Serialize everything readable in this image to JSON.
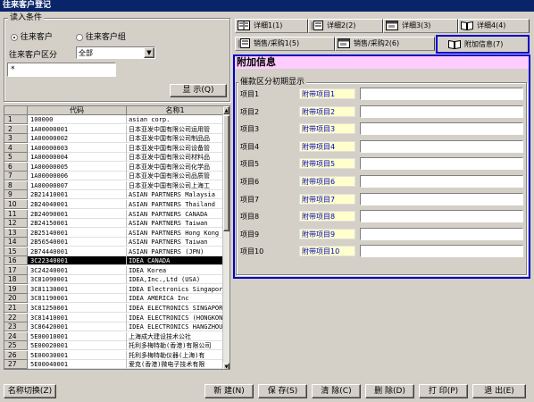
{
  "window": {
    "title": "往来客户登记"
  },
  "filter": {
    "group_label": "读入条件",
    "radio_customer": "往来客户",
    "radio_group": "往来客户组",
    "type_label": "往来客户区分",
    "type_value": "全部",
    "search_value": "*",
    "show_button": "显 示(Q)"
  },
  "grid": {
    "col_code": "代码",
    "col_name": "名称1",
    "rows": [
      {
        "n": "1",
        "code": "100000",
        "name": "asian corp."
      },
      {
        "n": "2",
        "code": "1A00000001",
        "name": "日本亚发中国有限公司运用管"
      },
      {
        "n": "3",
        "code": "1A00000002",
        "name": "日本亚发中国有限公司制品品"
      },
      {
        "n": "4",
        "code": "1A00000003",
        "name": "日本亚发中国有限公司设备管"
      },
      {
        "n": "5",
        "code": "1A00000004",
        "name": "日本亚发中国有限公司材料品"
      },
      {
        "n": "6",
        "code": "1A00000005",
        "name": "日本亚发中国有限公司化学品"
      },
      {
        "n": "7",
        "code": "1A00000006",
        "name": "日本亚发中国有限公司品质管"
      },
      {
        "n": "8",
        "code": "1A00000007",
        "name": "日本亚发中国有限公司上海工"
      },
      {
        "n": "9",
        "code": "2B21410001",
        "name": "ASIAN PARTNERS Malaysia"
      },
      {
        "n": "10",
        "code": "2B24040001",
        "name": "ASIAN PARTNERS Thailand"
      },
      {
        "n": "11",
        "code": "2B24090001",
        "name": "ASIAN PARTNERS CANADA"
      },
      {
        "n": "12",
        "code": "2B24150001",
        "name": "ASIAN PARTNERS Taiwan"
      },
      {
        "n": "13",
        "code": "2B25140001",
        "name": "ASIAN PARTNERS Hong Kong"
      },
      {
        "n": "14",
        "code": "2B56540001",
        "name": "ASIAN PARTNERS Taiwan"
      },
      {
        "n": "15",
        "code": "2B74440001",
        "name": "ASIAN PARTNERS (JPN)"
      },
      {
        "n": "16",
        "code": "3C22340001",
        "name": "IDEA CANADA"
      },
      {
        "n": "17",
        "code": "3C24240001",
        "name": "IDEA Korea"
      },
      {
        "n": "18",
        "code": "3C81090001",
        "name": "IDEA,Inc.,Ltd (USA)"
      },
      {
        "n": "19",
        "code": "3C81130001",
        "name": "IDEA Electronics Singapor"
      },
      {
        "n": "20",
        "code": "3C81190001",
        "name": "IDEA AMERICA Inc"
      },
      {
        "n": "21",
        "code": "3C81250001",
        "name": "IDEA ELECTRONICS SINGAPOR"
      },
      {
        "n": "22",
        "code": "3C81410001",
        "name": "IDEA ELECTRONICS (HONGKON"
      },
      {
        "n": "23",
        "code": "3C86420001",
        "name": "IDEA ELECTRONICS HANGZHOU"
      },
      {
        "n": "24",
        "code": "5E00010001",
        "name": "上海成大建设技术公社"
      },
      {
        "n": "25",
        "code": "5E00020001",
        "name": "托利多梅特勒(香港)有限公司"
      },
      {
        "n": "26",
        "code": "5E00030001",
        "name": "托利多梅特勒仪器(上海)有"
      },
      {
        "n": "27",
        "code": "5E00040001",
        "name": "爱克(香港)微电子技术有限"
      }
    ],
    "selected_index": 15
  },
  "tabs": {
    "row1": [
      "详细1(1)",
      "详细2(2)",
      "详细3(3)",
      "详细4(4)"
    ],
    "row2": [
      "销售/采购1(5)",
      "销售/采购2(6)",
      "附加信息(7)"
    ]
  },
  "panel": {
    "title": "附加信息",
    "group_label": "催款区分初期显示",
    "items": [
      {
        "label": "项目1",
        "value": "附带项目1"
      },
      {
        "label": "项目2",
        "value": "附带项目2"
      },
      {
        "label": "项目3",
        "value": "附带项目3"
      },
      {
        "label": "项目4",
        "value": "附带项目4"
      },
      {
        "label": "项目5",
        "value": "附带项目5"
      },
      {
        "label": "项目6",
        "value": "附带项目6"
      },
      {
        "label": "项目7",
        "value": "附带项目7"
      },
      {
        "label": "项目8",
        "value": "附带项目8"
      },
      {
        "label": "项目9",
        "value": "附带项目9"
      },
      {
        "label": "项目10",
        "value": "附带项目10"
      }
    ]
  },
  "footer": {
    "switch_name": "名称切换(Z)",
    "new": "新 建(N)",
    "save": "保 存(S)",
    "clear": "清 除(C)",
    "delete": "删 除(D)",
    "print": "打 印(P)",
    "exit": "退 出(E)"
  },
  "colors": {
    "title_bg": "#0a246a",
    "panel_title_bg": "#ffccff",
    "item_value_bg": "#ffffcc",
    "active_border": "#0000c8"
  }
}
